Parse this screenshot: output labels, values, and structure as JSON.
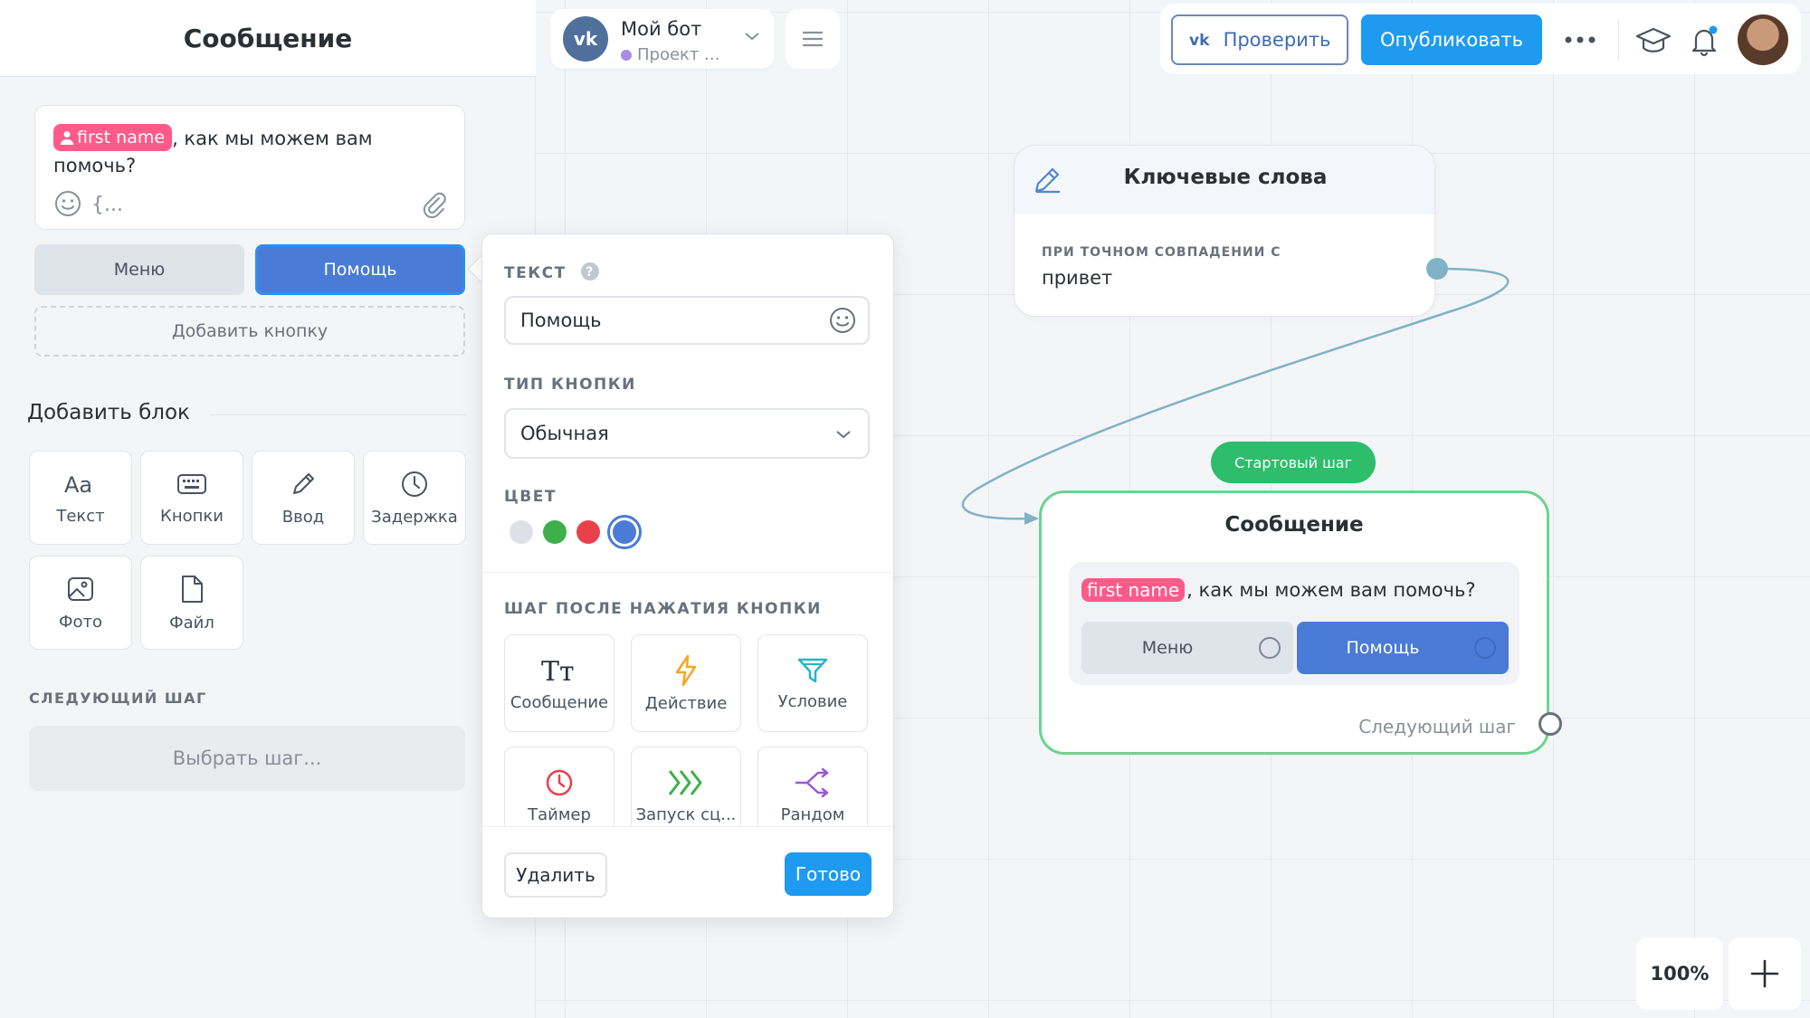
{
  "sidebar": {
    "title": "Сообщение",
    "message": {
      "variable": "first name",
      "text": ", как мы можем вам помочь?"
    },
    "buttons": [
      "Меню",
      "Помощь"
    ],
    "add_button_label": "Добавить кнопку",
    "add_block_title": "Добавить блок",
    "blocks": [
      {
        "label": "Текст",
        "icon": "text-aa-icon"
      },
      {
        "label": "Кнопки",
        "icon": "keyboard-icon"
      },
      {
        "label": "Ввод",
        "icon": "pencil-icon"
      },
      {
        "label": "Задержка",
        "icon": "clock-icon"
      },
      {
        "label": "Фото",
        "icon": "image-icon"
      },
      {
        "label": "Файл",
        "icon": "file-icon"
      }
    ],
    "next_step_label": "СЛЕДУЮЩИЙ ШАГ",
    "next_step_placeholder": "Выбрать шаг..."
  },
  "popover": {
    "text_label": "ТЕКСТ",
    "text_value": "Помощь",
    "type_label": "ТИП КНОПКИ",
    "type_value": "Обычная",
    "color_label": "ЦВЕТ",
    "colors": [
      "#dde1e7",
      "#3db04b",
      "#e8414b",
      "#4a7bd6"
    ],
    "selected_color": "#4a7bd6",
    "step_label": "ШАГ ПОСЛЕ НАЖАТИЯ КНОПКИ",
    "steps": [
      {
        "label": "Сообщение",
        "icon": "text-tt-icon",
        "color": "#2b2f36"
      },
      {
        "label": "Действие",
        "icon": "lightning-icon",
        "color": "#f5a623"
      },
      {
        "label": "Условие",
        "icon": "filter-icon",
        "color": "#26b5c8"
      },
      {
        "label": "Таймер",
        "icon": "timer-icon",
        "color": "#e8414b"
      },
      {
        "label": "Запуск сц...",
        "icon": "chevrons-icon",
        "color": "#3db04b"
      },
      {
        "label": "Рандом",
        "icon": "random-icon",
        "color": "#9b59d9"
      }
    ],
    "delete_label": "Удалить",
    "done_label": "Готово"
  },
  "topbar": {
    "bot_name": "Мой бот",
    "bot_project": "Проект ...",
    "vk_logo": "vk",
    "check_label": "Проверить",
    "publish_label": "Опубликовать"
  },
  "canvas": {
    "keyword_node": {
      "title": "Ключевые слова",
      "condition": "ПРИ ТОЧНОМ СОВПАДЕНИИ С",
      "value": "привет"
    },
    "start_badge": "Стартовый шаг",
    "message_node": {
      "title": "Сообщение",
      "variable": "first name",
      "text": ", как мы можем вам помочь?",
      "buttons": [
        "Меню",
        "Помощь"
      ],
      "next_step": "Следующий шаг"
    },
    "zoom": "100%"
  }
}
